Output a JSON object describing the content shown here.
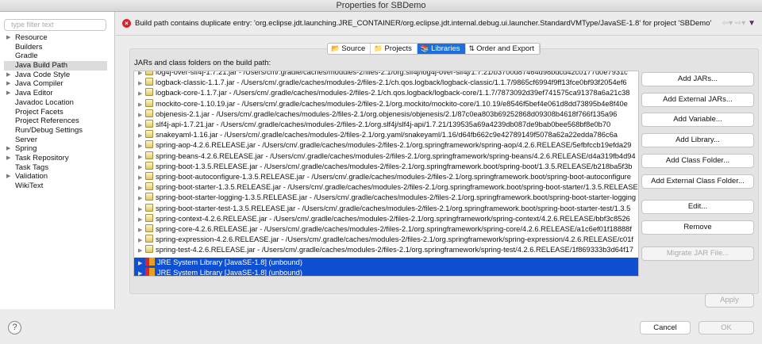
{
  "window": {
    "title": "Properties for SBDemo"
  },
  "sidebar": {
    "filter_placeholder": "type filter text",
    "items": [
      {
        "label": "Resource",
        "expandable": true
      },
      {
        "label": "Builders",
        "expandable": false
      },
      {
        "label": "Gradle",
        "expandable": false
      },
      {
        "label": "Java Build Path",
        "expandable": false,
        "selected": true
      },
      {
        "label": "Java Code Style",
        "expandable": true
      },
      {
        "label": "Java Compiler",
        "expandable": true
      },
      {
        "label": "Java Editor",
        "expandable": true
      },
      {
        "label": "Javadoc Location",
        "expandable": false
      },
      {
        "label": "Project Facets",
        "expandable": false
      },
      {
        "label": "Project References",
        "expandable": false
      },
      {
        "label": "Run/Debug Settings",
        "expandable": false
      },
      {
        "label": "Server",
        "expandable": false
      },
      {
        "label": "Spring",
        "expandable": true
      },
      {
        "label": "Task Repository",
        "expandable": true
      },
      {
        "label": "Task Tags",
        "expandable": false
      },
      {
        "label": "Validation",
        "expandable": true
      },
      {
        "label": "WikiText",
        "expandable": false
      }
    ]
  },
  "message": {
    "icon": "error-icon",
    "text": "Build path contains duplicate entry: 'org.eclipse.jdt.launching.JRE_CONTAINER/org.eclipse.jdt.internal.debug.ui.launcher.StandardVMType/JavaSE-1.8' for project 'SBDemo'"
  },
  "tabs": [
    {
      "label": "Source",
      "icon": "source-folder-icon"
    },
    {
      "label": "Projects",
      "icon": "folder-icon"
    },
    {
      "label": "Libraries",
      "icon": "library-icon",
      "active": true
    },
    {
      "label": "Order and Export",
      "icon": "order-icon"
    }
  ],
  "libraries": {
    "label": "JARs and class folders on the build path:",
    "entries": [
      {
        "text": "log4j-over-slf4j-1.7.21.jar - /Users/cm/.gradle/caches/modules-2/files-2.1/org.slf4j/log4j-over-slf4j/1.7.21/b3700d87464d98bdcd42c0177d0e7931c",
        "type": "jar"
      },
      {
        "text": "logback-classic-1.1.7.jar - /Users/cm/.gradle/caches/modules-2/files-2.1/ch.qos.logback/logback-classic/1.1.7/9865cf6994f9ff13fce0bf93f2054ef6",
        "type": "jar"
      },
      {
        "text": "logback-core-1.1.7.jar - /Users/cm/.gradle/caches/modules-2/files-2.1/ch.qos.logback/logback-core/1.1.7/7873092d39ef741575ca91378a6a21c38",
        "type": "jar"
      },
      {
        "text": "mockito-core-1.10.19.jar - /Users/cm/.gradle/caches/modules-2/files-2.1/org.mockito/mockito-core/1.10.19/e8546f5bef4e061d8dd73895b4e8f40e",
        "type": "jar"
      },
      {
        "text": "objenesis-2.1.jar - /Users/cm/.gradle/caches/modules-2/files-2.1/org.objenesis/objenesis/2.1/87c0ea803b69252868d09308b4618f766f135a96",
        "type": "jar"
      },
      {
        "text": "slf4j-api-1.7.21.jar - /Users/cm/.gradle/caches/modules-2/files-2.1/org.slf4j/slf4j-api/1.7.21/139535a69a4239db087de9bab0bee568bf8e0b70",
        "type": "jar"
      },
      {
        "text": "snakeyaml-1.16.jar - /Users/cm/.gradle/caches/modules-2/files-2.1/org.yaml/snakeyaml/1.16/d64fb662c9e42789149f5078a62a22edda786c6a",
        "type": "jar"
      },
      {
        "text": "spring-aop-4.2.6.RELEASE.jar - /Users/cm/.gradle/caches/modules-2/files-2.1/org.springframework/spring-aop/4.2.6.RELEASE/5efbfccb19efda29",
        "type": "jar"
      },
      {
        "text": "spring-beans-4.2.6.RELEASE.jar - /Users/cm/.gradle/caches/modules-2/files-2.1/org.springframework/spring-beans/4.2.6.RELEASE/d4a319fb4d94",
        "type": "jar"
      },
      {
        "text": "spring-boot-1.3.5.RELEASE.jar - /Users/cm/.gradle/caches/modules-2/files-2.1/org.springframework.boot/spring-boot/1.3.5.RELEASE/b218ba5f3b",
        "type": "jar"
      },
      {
        "text": "spring-boot-autoconfigure-1.3.5.RELEASE.jar - /Users/cm/.gradle/caches/modules-2/files-2.1/org.springframework.boot/spring-boot-autoconfigure",
        "type": "jar"
      },
      {
        "text": "spring-boot-starter-1.3.5.RELEASE.jar - /Users/cm/.gradle/caches/modules-2/files-2.1/org.springframework.boot/spring-boot-starter/1.3.5.RELEASE",
        "type": "jar"
      },
      {
        "text": "spring-boot-starter-logging-1.3.5.RELEASE.jar - /Users/cm/.gradle/caches/modules-2/files-2.1/org.springframework.boot/spring-boot-starter-logging",
        "type": "jar"
      },
      {
        "text": "spring-boot-starter-test-1.3.5.RELEASE.jar - /Users/cm/.gradle/caches/modules-2/files-2.1/org.springframework.boot/spring-boot-starter-test/1.3.5",
        "type": "jar"
      },
      {
        "text": "spring-context-4.2.6.RELEASE.jar - /Users/cm/.gradle/caches/modules-2/files-2.1/org.springframework/spring-context/4.2.6.RELEASE/bbf3c8526",
        "type": "jar"
      },
      {
        "text": "spring-core-4.2.6.RELEASE.jar - /Users/cm/.gradle/caches/modules-2/files-2.1/org.springframework/spring-core/4.2.6.RELEASE/a1c6ef01f18888f",
        "type": "jar"
      },
      {
        "text": "spring-expression-4.2.6.RELEASE.jar - /Users/cm/.gradle/caches/modules-2/files-2.1/org.springframework/spring-expression/4.2.6.RELEASE/c01f",
        "type": "jar"
      },
      {
        "text": "spring-test-4.2.6.RELEASE.jar - /Users/cm/.gradle/caches/modules-2/files-2.1/org.springframework/spring-test/4.2.6.RELEASE/1f869333b3d64f17",
        "type": "jar"
      },
      {
        "text": "JRE System Library [JavaSE-1.8] (unbound)",
        "type": "jre",
        "selected": true
      },
      {
        "text": "JRE System Library [JavaSE-1.8] (unbound)",
        "type": "jre",
        "selected": true
      }
    ]
  },
  "buttons": [
    {
      "label": "Add JARs..."
    },
    {
      "label": "Add External JARs..."
    },
    {
      "label": "Add Variable..."
    },
    {
      "label": "Add Library..."
    },
    {
      "label": "Add Class Folder..."
    },
    {
      "label": "Add External Class Folder..."
    },
    {
      "label": "Edit..."
    },
    {
      "label": "Remove"
    },
    {
      "label": "Migrate JAR File...",
      "disabled": true
    }
  ],
  "footer": {
    "apply": "Apply",
    "cancel": "Cancel",
    "ok": "OK",
    "help": "?"
  },
  "colors": {
    "selection": "#0f4fd1",
    "active_tab": "#1d6fe0",
    "error": "#d6262d"
  }
}
